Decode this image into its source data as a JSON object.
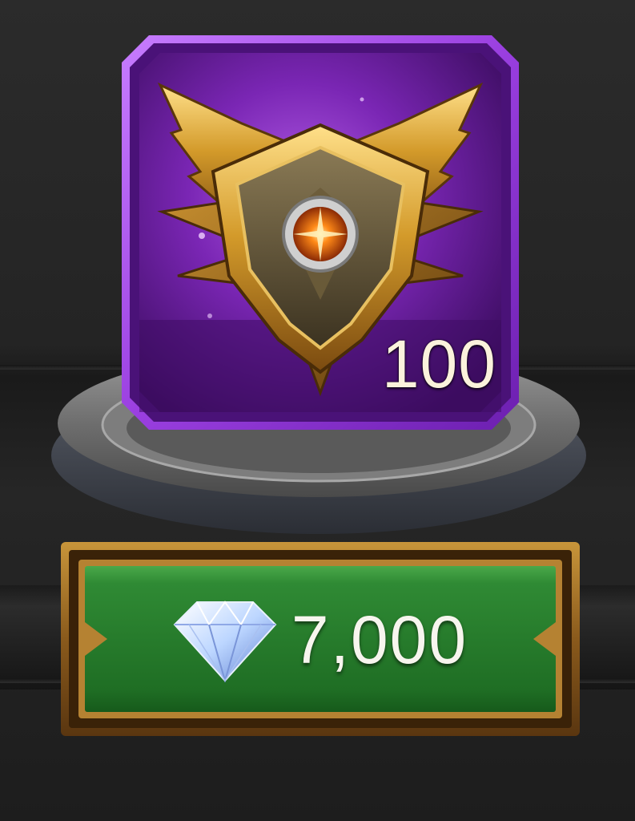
{
  "item": {
    "name_icon": "gold-winged-shield-emblem-icon",
    "count": "100",
    "rarity_color": "#8a2fd0"
  },
  "purchase": {
    "currency_icon": "diamond-gem-icon",
    "price": "7,000",
    "button_color": "#2f8a34"
  }
}
